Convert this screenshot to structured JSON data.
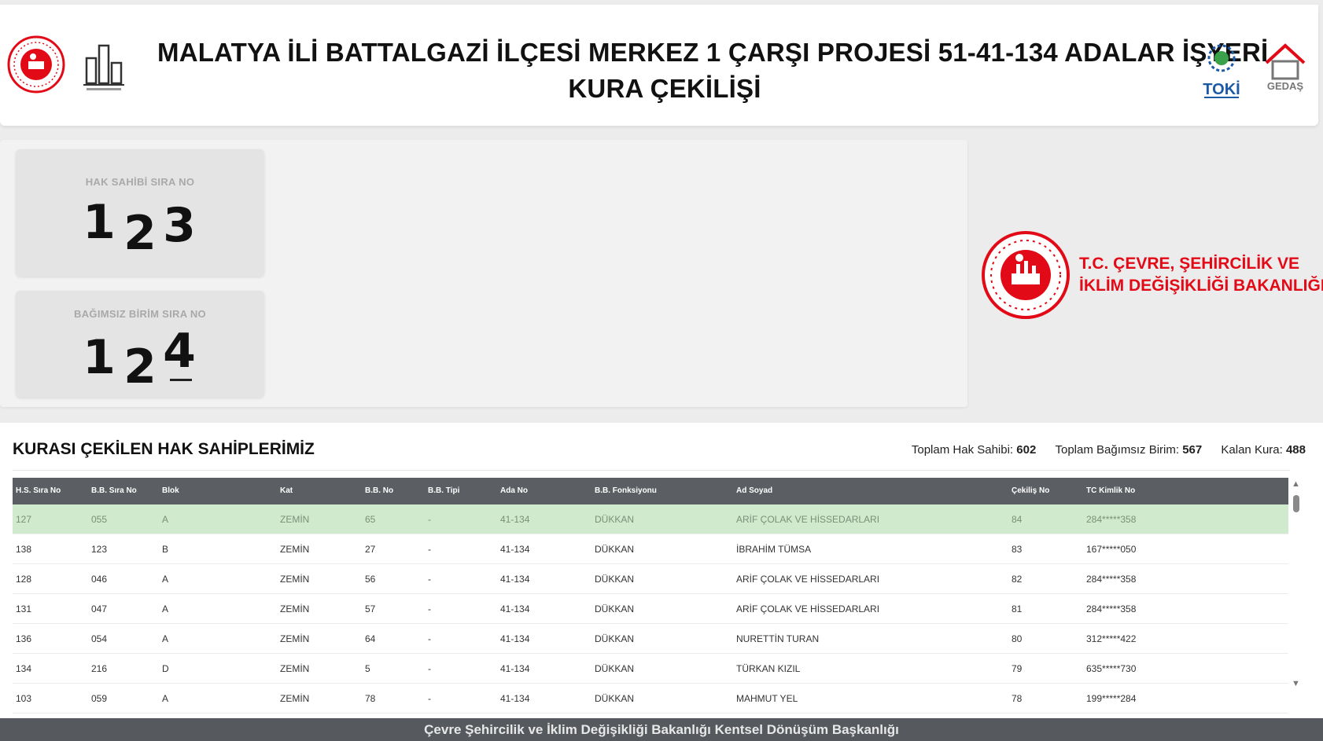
{
  "header": {
    "title_line1": "MALATYA İLİ BATTALGAZİ İLÇESİ MERKEZ 1 ÇARŞI PROJESİ 51-41-134 ADALAR İŞYERİ",
    "title_line2": "KURA ÇEKİLİŞİ",
    "logo_toki_text": "TOKİ",
    "logo_gedas_text": "GEDAŞ",
    "brand_red": "#e30a17",
    "toki_blue": "#1c5aa8",
    "toki_green": "#3aa14a"
  },
  "draw": {
    "box1": {
      "label": "HAK SAHİBİ SIRA NO",
      "d1": "1",
      "d2": "2",
      "d3": "3"
    },
    "box2": {
      "label": "BAĞIMSIZ BİRİM SIRA NO",
      "d1": "1",
      "d2": "2",
      "d3": "4"
    }
  },
  "ministry": {
    "line1": "T.C. ÇEVRE, ŞEHİRCİLİK VE",
    "line2": "İKLİM DEĞİŞİKLİĞİ BAKANLIĞI"
  },
  "results": {
    "title": "KURASI ÇEKİLEN HAK SAHİPLERİMİZ",
    "stats": {
      "total_owners_label": "Toplam Hak Sahibi:",
      "total_owners": "602",
      "total_units_label": "Toplam Bağımsız Birim:",
      "total_units": "567",
      "remaining_label": "Kalan Kura:",
      "remaining": "488"
    },
    "columns": [
      "H.S. Sıra No",
      "B.B. Sıra No",
      "Blok",
      "Kat",
      "B.B. No",
      "B.B. Tipi",
      "Ada No",
      "B.B. Fonksiyonu",
      "Ad Soyad",
      "Çekiliş No",
      "TC Kimlik No"
    ],
    "rows": [
      [
        "127",
        "055",
        "A",
        "ZEMİN",
        "65",
        "-",
        "41-134",
        "DÜKKAN",
        "ARİF ÇOLAK VE HİSSEDARLARI",
        "84",
        "284*****358"
      ],
      [
        "138",
        "123",
        "B",
        "ZEMİN",
        "27",
        "-",
        "41-134",
        "DÜKKAN",
        "İBRAHİM TÜMSA",
        "83",
        "167*****050"
      ],
      [
        "128",
        "046",
        "A",
        "ZEMİN",
        "56",
        "-",
        "41-134",
        "DÜKKAN",
        "ARİF ÇOLAK VE HİSSEDARLARI",
        "82",
        "284*****358"
      ],
      [
        "131",
        "047",
        "A",
        "ZEMİN",
        "57",
        "-",
        "41-134",
        "DÜKKAN",
        "ARİF ÇOLAK VE HİSSEDARLARI",
        "81",
        "284*****358"
      ],
      [
        "136",
        "054",
        "A",
        "ZEMİN",
        "64",
        "-",
        "41-134",
        "DÜKKAN",
        "NURETTİN TURAN",
        "80",
        "312*****422"
      ],
      [
        "134",
        "216",
        "D",
        "ZEMİN",
        "5",
        "-",
        "41-134",
        "DÜKKAN",
        "TÜRKAN KIZIL",
        "79",
        "635*****730"
      ],
      [
        "103",
        "059",
        "A",
        "ZEMİN",
        "78",
        "-",
        "41-134",
        "DÜKKAN",
        "MAHMUT YEL",
        "78",
        "199*****284"
      ]
    ],
    "highlight_color": "#cfeacd"
  },
  "footer": {
    "text": "Çevre Şehircilik ve İklim Değişikliği Bakanlığı Kentsel Dönüşüm Başkanlığı"
  }
}
